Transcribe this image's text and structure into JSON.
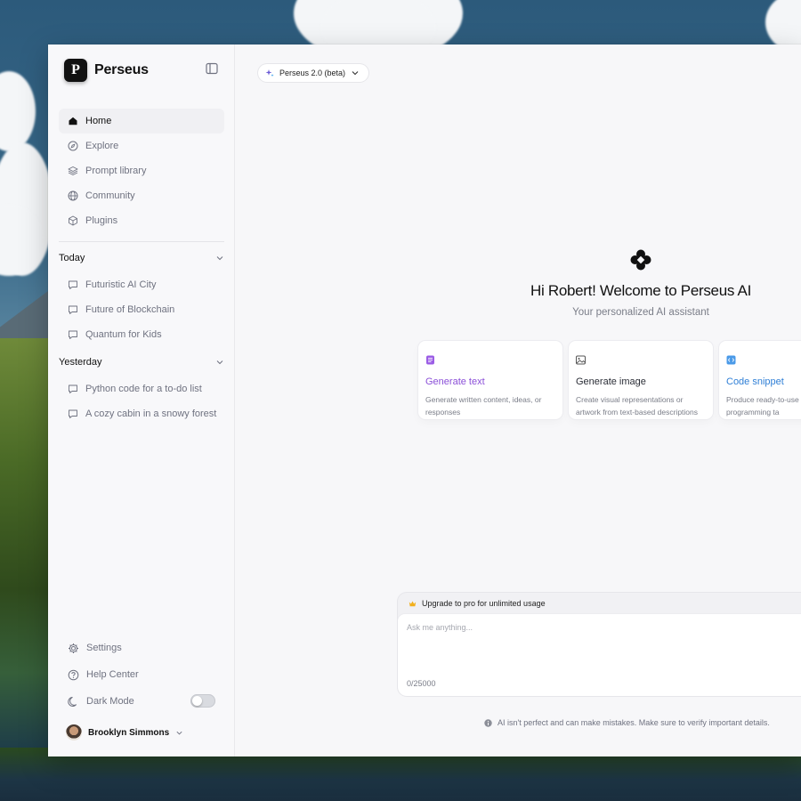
{
  "app": {
    "name": "Perseus",
    "logo_letter": "P"
  },
  "sidebar": {
    "nav": [
      {
        "label": "Home",
        "icon": "home-icon",
        "active": true
      },
      {
        "label": "Explore",
        "icon": "compass-icon",
        "active": false
      },
      {
        "label": "Prompt library",
        "icon": "layers-icon",
        "active": false
      },
      {
        "label": "Community",
        "icon": "globe-icon",
        "active": false
      },
      {
        "label": "Plugins",
        "icon": "cube-icon",
        "active": false
      }
    ],
    "today": {
      "title": "Today",
      "items": [
        "Futuristic AI City",
        "Future of Blockchain",
        "Quantum for Kids"
      ]
    },
    "yesterday": {
      "title": "Yesterday",
      "items": [
        "Python code for a to-do list",
        "A cozy cabin in a snowy forest"
      ]
    },
    "bottom": {
      "settings": "Settings",
      "help": "Help Center",
      "dark_mode": "Dark Mode",
      "dark_mode_on": false
    },
    "user": {
      "name": "Brooklyn Simmons"
    }
  },
  "main": {
    "model": "Perseus 2.0 (beta)",
    "welcome": "Hi Robert! Welcome to Perseus AI",
    "subtitle": "Your personalized AI assistant",
    "cards": [
      {
        "title": "Generate text",
        "desc": "Generate written content, ideas, or responses",
        "color": "#8b4fd8",
        "icon": "document-icon"
      },
      {
        "title": "Generate image",
        "desc": "Create visual representations or artwork from text-based descriptions",
        "color": "#2a2d36",
        "icon": "image-icon"
      },
      {
        "title": "Code snippet",
        "desc": "Produce ready-to-use c specific programming ta",
        "color": "#2f7fd6",
        "icon": "code-icon"
      }
    ],
    "composer": {
      "upgrade": "Upgrade to pro for unlimited usage",
      "placeholder": "Ask me anything...",
      "counter": "0/25000"
    },
    "disclaimer": "AI isn't perfect and can make mistakes. Make sure to verify important details."
  },
  "colors": {
    "accent_text": "#8b4fd8",
    "code_text": "#2f7fd6",
    "crown": "#f2b01e"
  }
}
